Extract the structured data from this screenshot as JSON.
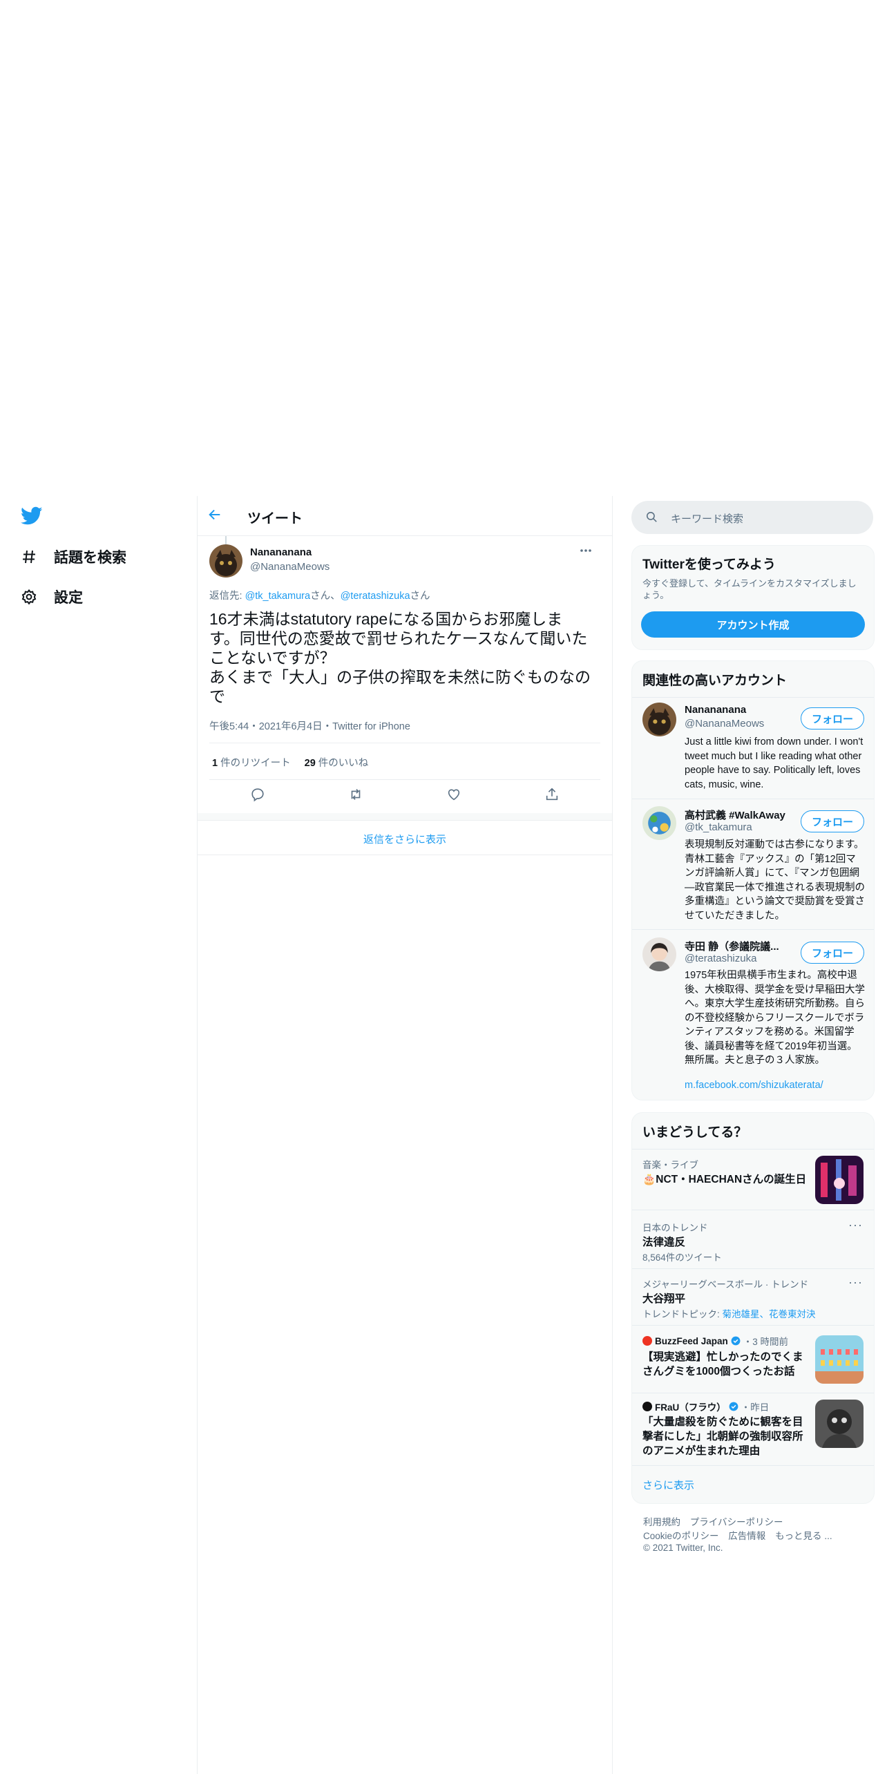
{
  "nav": {
    "explore_label": "話題を検索",
    "settings_label": "設定"
  },
  "header": {
    "title": "ツイート"
  },
  "tweet": {
    "author_name": "Nanananana",
    "author_handle": "@NananaMeows",
    "reply_prefix": "返信先: ",
    "reply_to_1": "@tk_takamura",
    "reply_sep_1": "さん、",
    "reply_to_2": "@teratashizuka",
    "reply_sep_2": "さん",
    "text_line1": "16才未満はstatutory rapeになる国からお邪魔しま",
    "text_line2": "す。同世代の恋愛故で罰せられたケースなんて聞いた",
    "text_line3": "ことないですが？",
    "text_line4": "あくまで「大人」の子供の搾取を未然に防ぐものなの",
    "text_line5": "で",
    "timestamp": "午後5:44・2021年6月4日・Twitter for iPhone",
    "retweet_count": "1",
    "retweet_label": " 件のリツイート",
    "like_count": "29",
    "like_label": " 件のいいね",
    "more_replies": "返信をさらに表示"
  },
  "search": {
    "placeholder": "キーワード検索"
  },
  "signup": {
    "title": "Twitterを使ってみよう",
    "desc": "今すぐ登録して、タイムラインをカスタマイズしましょう。",
    "button": "アカウント作成"
  },
  "related": {
    "title": "関連性の高いアカウント",
    "follow_label": "フォロー",
    "accounts": [
      {
        "name": "Nanananana",
        "handle": "@NananaMeows",
        "bio": "Just a little kiwi from down under. I won't tweet much but I like reading what other people have to say. Politically left, loves cats, music, wine."
      },
      {
        "name": "高村武義 #WalkAway",
        "handle": "@tk_takamura",
        "bio": "表現規制反対運動では古参になります。青林工藝舎『アックス』の「第12回マンガ評論新人賞」にて、『マンガ包囲網 ―政官業民一体で推進される表現規制の多重構造』という論文で奨励賞を受賞させていただきました。"
      },
      {
        "name": "寺田 静（参議院議...",
        "handle": "@teratashizuka",
        "bio": "1975年秋田県横手市生まれ。高校中退後、大検取得、奨学金を受け早稲田大学へ。東京大学生産技術研究所勤務。自らの不登校経験からフリースクールでボランティアスタッフを務める。米国留学後、議員秘書等を経て2019年初当選。無所属。夫と息子の３人家族。",
        "link": "m.facebook.com/shizukaterata/"
      }
    ]
  },
  "trends": {
    "title": "いまどうしてる？",
    "items": [
      {
        "meta": "音楽・ライブ",
        "title": "🎂NCT・HAECHANさんの誕生日"
      },
      {
        "meta": "日本のトレンド",
        "title": "法律違反",
        "sub": "8,564件のツイート"
      },
      {
        "meta": "メジャーリーグベースボール · トレンド",
        "title": "大谷翔平",
        "sub_prefix": "トレンドトピック: ",
        "sub_links": "菊池雄星、花巻東対決"
      },
      {
        "source": "BuzzFeed Japan",
        "time": "・3 時間前",
        "title_l1": "【現実逃避】忙しかったのでくま",
        "title_l2": "さんグミを1000個つくったお話"
      },
      {
        "source": "FRaU（フラウ）",
        "time": "・昨日",
        "title_l1": "「大量虐殺を防ぐために観客を目",
        "title_l2": "撃者にした」北朝鮮の強制収容所",
        "title_l3": "のアニメが生まれた理由"
      }
    ],
    "more": "さらに表示"
  },
  "footer": {
    "terms": "利用規約",
    "privacy": "プライバシーポリシー",
    "cookie": "Cookieのポリシー",
    "ads": "広告情報",
    "more": "もっと見る ...",
    "copyright": "© 2021 Twitter, Inc."
  },
  "colors": {
    "accent": "#1d9bf0",
    "text": "#0f1419",
    "muted": "#5b7083",
    "panel": "#f7f9f9"
  },
  "icons": [
    "twitter-bird-icon",
    "hashtag-icon",
    "gear-icon",
    "back-arrow-icon",
    "more-icon",
    "reply-icon",
    "retweet-icon",
    "like-icon",
    "share-icon",
    "search-icon",
    "verified-icon"
  ]
}
